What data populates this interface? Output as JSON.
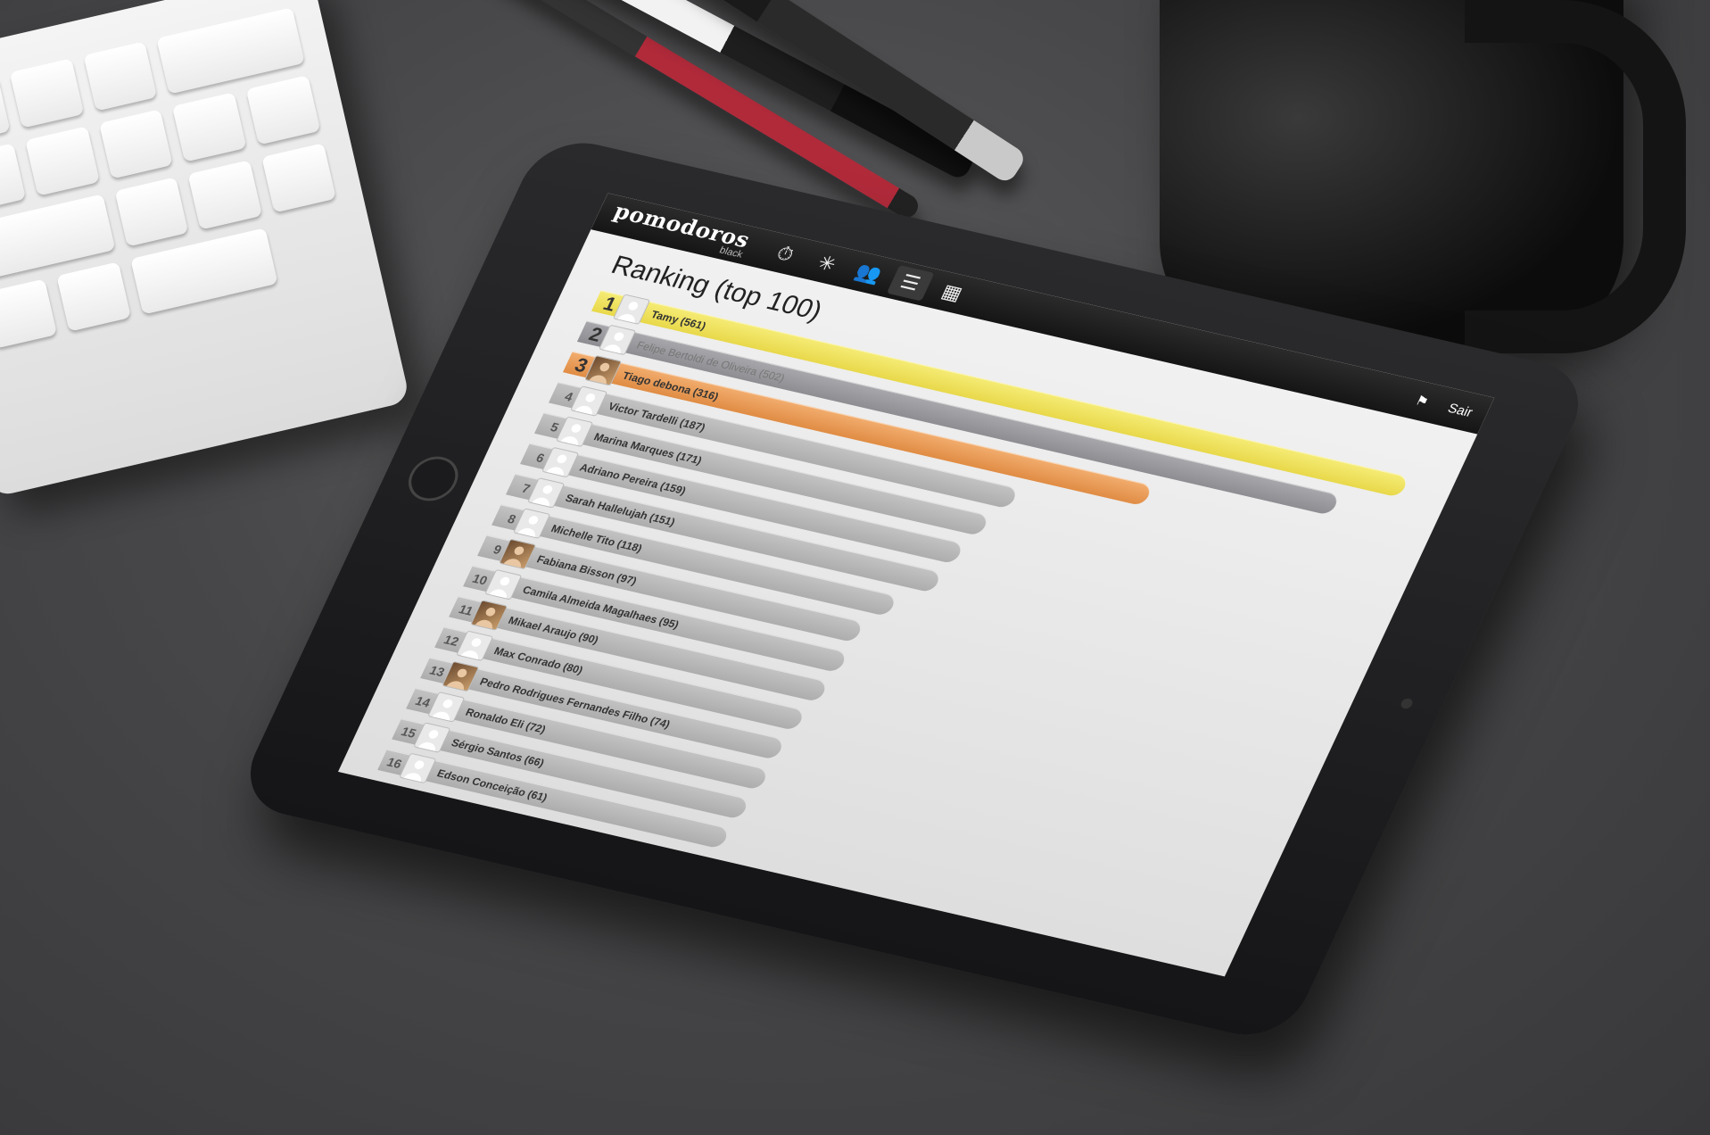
{
  "app": {
    "brand_name": "pomodoros",
    "brand_sub": "black"
  },
  "nav": {
    "icons": [
      "pomodoro-timer-icon",
      "activity-icon",
      "users-icon",
      "ranking-icon",
      "calendar-icon"
    ],
    "message_icon": "message-icon",
    "logout_label": "Sair"
  },
  "page": {
    "title": "Ranking (top 100)"
  },
  "ranking": [
    {
      "rank": "1",
      "name": "Tamy",
      "score": 561,
      "tier": "gold",
      "photo": false
    },
    {
      "rank": "2",
      "name": "Felipe Bertoldi de Oliveira",
      "score": 502,
      "tier": "silver",
      "photo": false
    },
    {
      "rank": "3",
      "name": "Tiago debona",
      "score": 316,
      "tier": "bronze",
      "photo": true
    },
    {
      "rank": "4",
      "name": "Victor Tardelli",
      "score": 187,
      "tier": "",
      "photo": false
    },
    {
      "rank": "5",
      "name": "Marina Marques",
      "score": 171,
      "tier": "",
      "photo": false
    },
    {
      "rank": "6",
      "name": "Adriano Pereira",
      "score": 159,
      "tier": "",
      "photo": false
    },
    {
      "rank": "7",
      "name": "Sarah Hallelujah",
      "score": 151,
      "tier": "",
      "photo": false
    },
    {
      "rank": "8",
      "name": "Michelle Tito",
      "score": 118,
      "tier": "",
      "photo": false
    },
    {
      "rank": "9",
      "name": "Fabiana Bisson",
      "score": 97,
      "tier": "",
      "photo": true
    },
    {
      "rank": "10",
      "name": "Camila Almeida Magalhaes",
      "score": 95,
      "tier": "",
      "photo": false
    },
    {
      "rank": "11",
      "name": "Mikael Araujo",
      "score": 90,
      "tier": "",
      "photo": true
    },
    {
      "rank": "12",
      "name": "Max Conrado",
      "score": 80,
      "tier": "",
      "photo": false
    },
    {
      "rank": "13",
      "name": "Pedro Rodrigues Fernandes Filho",
      "score": 74,
      "tier": "",
      "photo": true
    },
    {
      "rank": "14",
      "name": "Ronaldo Eli",
      "score": 72,
      "tier": "",
      "photo": false
    },
    {
      "rank": "15",
      "name": "Sérgio Santos",
      "score": 66,
      "tier": "",
      "photo": false
    },
    {
      "rank": "16",
      "name": "Edson Conceição",
      "score": 61,
      "tier": "",
      "photo": false
    }
  ]
}
